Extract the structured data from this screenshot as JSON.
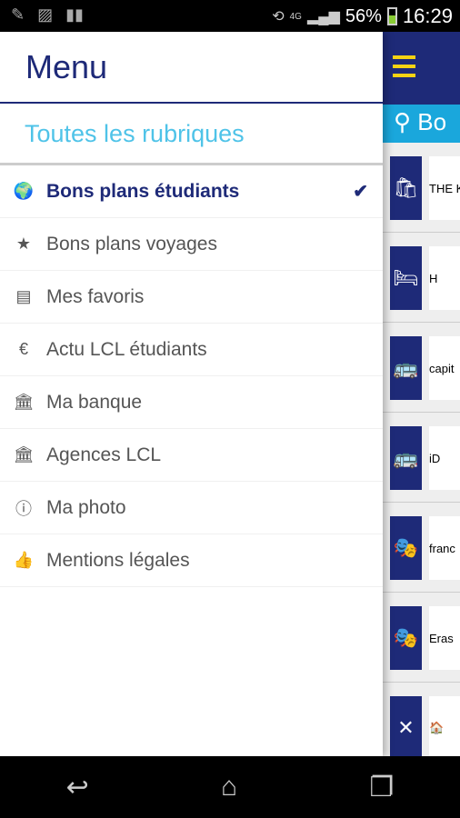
{
  "status_bar": {
    "battery": "56%",
    "time": "16:29",
    "network": "4G"
  },
  "drawer": {
    "title": "Menu",
    "section": "Toutes les rubriques",
    "items": [
      {
        "label": "Bons plans étudiants",
        "icon": "globe-icon",
        "glyph": "🌍",
        "active": true
      },
      {
        "label": "Bons plans voyages",
        "icon": "star-icon",
        "glyph": "★"
      },
      {
        "label": "Mes favoris",
        "icon": "newspaper-icon",
        "glyph": "▤"
      },
      {
        "label": "Actu LCL étudiants",
        "icon": "euro-bank-icon",
        "glyph": "€"
      },
      {
        "label": "Ma banque",
        "icon": "bank-icon",
        "glyph": "🏛"
      },
      {
        "label": "Agences LCL",
        "icon": "institution-icon",
        "glyph": "🏛"
      },
      {
        "label": "Ma photo",
        "icon": "info-icon",
        "glyph": "ⓘ"
      },
      {
        "label": "Mentions légales",
        "icon": "thumbs-up-icon",
        "glyph": "👍"
      }
    ],
    "check": "✔"
  },
  "panel": {
    "search_text": "Bo",
    "cards": [
      {
        "icon": "shopping-bag-icon",
        "glyph": "🛍",
        "logo": "THE K"
      },
      {
        "icon": "bed-icon",
        "glyph": "🛏",
        "logo": "H"
      },
      {
        "icon": "bus-icon",
        "glyph": "🚌",
        "logo": "capit"
      },
      {
        "icon": "bus-icon",
        "glyph": "🚌",
        "logo": "iD"
      },
      {
        "icon": "theater-masks-icon",
        "glyph": "🎭",
        "logo": "franc"
      },
      {
        "icon": "theater-masks-icon",
        "glyph": "🎭",
        "logo": "Eras"
      },
      {
        "icon": "restaurant-icon",
        "glyph": "✕",
        "logo": "🏠"
      }
    ]
  },
  "colors": {
    "brand": "#1e2a78",
    "accent": "#1aa7dc",
    "menu_icon": "#f5d214"
  }
}
